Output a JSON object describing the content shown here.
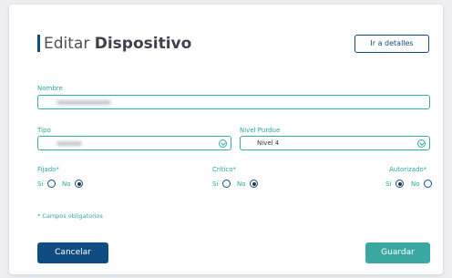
{
  "header": {
    "title_light": "Editar",
    "title_bold": "Dispositivo",
    "details_button": "Ir a detalles"
  },
  "form": {
    "nombre": {
      "label": "Nombre",
      "value": ""
    },
    "tipo": {
      "label": "Tipo",
      "value": ""
    },
    "nivel_purdue": {
      "label": "Nivel Purdue",
      "value": "Nivel 4"
    },
    "fijado": {
      "label": "Fijado*",
      "options": [
        "Sí",
        "No"
      ],
      "selected": "No"
    },
    "critico": {
      "label": "Crítico*",
      "options": [
        "Sí",
        "No"
      ],
      "selected": "No"
    },
    "autorizado": {
      "label": "Autorizado*",
      "options": [
        "Sí",
        "No"
      ],
      "selected": "Sí"
    },
    "required_note": "* Campos obligatorios"
  },
  "footer": {
    "cancel_label": "Cancelar",
    "save_label": "Guardar"
  },
  "colors": {
    "primary": "#0f4c81",
    "accent": "#2fb0a6",
    "save_button": "#3aa8a1"
  }
}
